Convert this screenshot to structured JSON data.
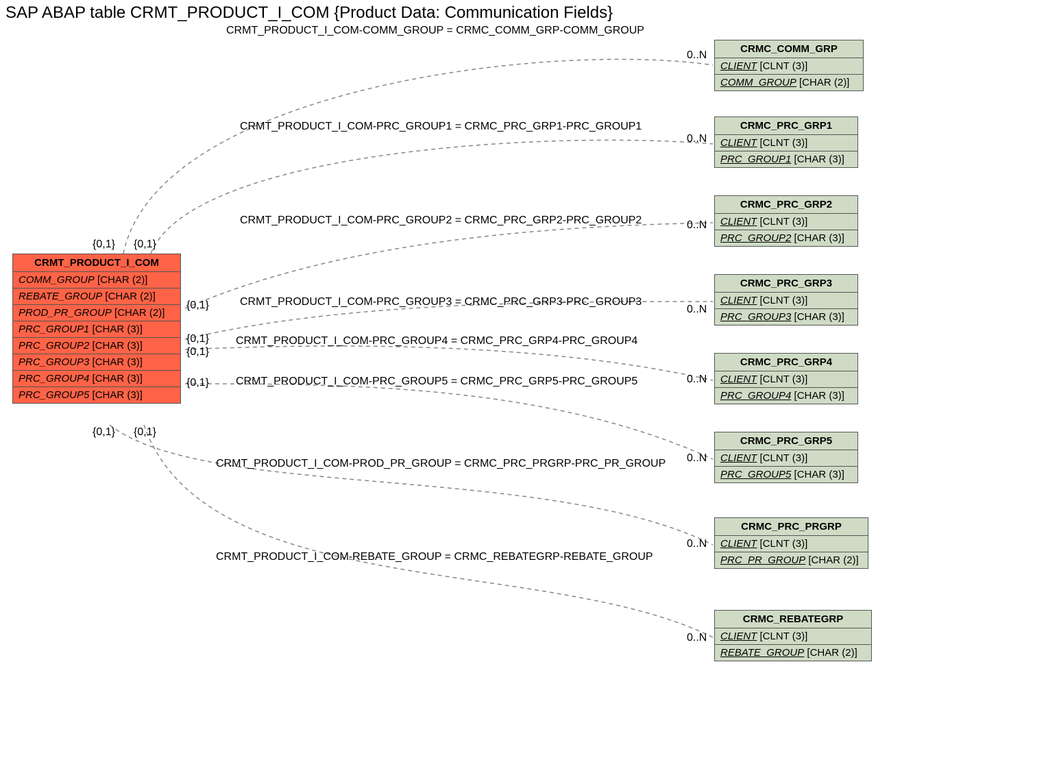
{
  "title": "SAP ABAP table CRMT_PRODUCT_I_COM {Product Data: Communication Fields}",
  "mainEntity": {
    "name": "CRMT_PRODUCT_I_COM",
    "fields": [
      {
        "name": "COMM_GROUP",
        "type": "[CHAR (2)]"
      },
      {
        "name": "REBATE_GROUP",
        "type": "[CHAR (2)]"
      },
      {
        "name": "PROD_PR_GROUP",
        "type": "[CHAR (2)]"
      },
      {
        "name": "PRC_GROUP1",
        "type": "[CHAR (3)]"
      },
      {
        "name": "PRC_GROUP2",
        "type": "[CHAR (3)]"
      },
      {
        "name": "PRC_GROUP3",
        "type": "[CHAR (3)]"
      },
      {
        "name": "PRC_GROUP4",
        "type": "[CHAR (3)]"
      },
      {
        "name": "PRC_GROUP5",
        "type": "[CHAR (3)]"
      }
    ]
  },
  "refEntities": [
    {
      "name": "CRMC_COMM_GRP",
      "fields": [
        {
          "name": "CLIENT",
          "type": "[CLNT (3)]",
          "u": true
        },
        {
          "name": "COMM_GROUP",
          "type": "[CHAR (2)]",
          "u": true
        }
      ]
    },
    {
      "name": "CRMC_PRC_GRP1",
      "fields": [
        {
          "name": "CLIENT",
          "type": "[CLNT (3)]",
          "u": true
        },
        {
          "name": "PRC_GROUP1",
          "type": "[CHAR (3)]",
          "u": true
        }
      ]
    },
    {
      "name": "CRMC_PRC_GRP2",
      "fields": [
        {
          "name": "CLIENT",
          "type": "[CLNT (3)]",
          "u": true
        },
        {
          "name": "PRC_GROUP2",
          "type": "[CHAR (3)]",
          "u": true
        }
      ]
    },
    {
      "name": "CRMC_PRC_GRP3",
      "fields": [
        {
          "name": "CLIENT",
          "type": "[CLNT (3)]",
          "u": true
        },
        {
          "name": "PRC_GROUP3",
          "type": "[CHAR (3)]",
          "u": true
        }
      ]
    },
    {
      "name": "CRMC_PRC_GRP4",
      "fields": [
        {
          "name": "CLIENT",
          "type": "[CLNT (3)]",
          "u": true
        },
        {
          "name": "PRC_GROUP4",
          "type": "[CHAR (3)]",
          "u": true
        }
      ]
    },
    {
      "name": "CRMC_PRC_GRP5",
      "fields": [
        {
          "name": "CLIENT",
          "type": "[CLNT (3)]",
          "u": true
        },
        {
          "name": "PRC_GROUP5",
          "type": "[CHAR (3)]",
          "u": true
        }
      ]
    },
    {
      "name": "CRMC_PRC_PRGRP",
      "fields": [
        {
          "name": "CLIENT",
          "type": "[CLNT (3)]",
          "u": true
        },
        {
          "name": "PRC_PR_GROUP",
          "type": "[CHAR (2)]",
          "u": true
        }
      ]
    },
    {
      "name": "CRMC_REBATEGRP",
      "fields": [
        {
          "name": "CLIENT",
          "type": "[CLNT (3)]",
          "u": true
        },
        {
          "name": "REBATE_GROUP",
          "type": "[CHAR (2)]",
          "u": true
        }
      ]
    }
  ],
  "relLabels": [
    "CRMT_PRODUCT_I_COM-COMM_GROUP = CRMC_COMM_GRP-COMM_GROUP",
    "CRMT_PRODUCT_I_COM-PRC_GROUP1 = CRMC_PRC_GRP1-PRC_GROUP1",
    "CRMT_PRODUCT_I_COM-PRC_GROUP2 = CRMC_PRC_GRP2-PRC_GROUP2",
    "CRMT_PRODUCT_I_COM-PRC_GROUP3 = CRMC_PRC_GRP3-PRC_GROUP3",
    "CRMT_PRODUCT_I_COM-PRC_GROUP4 = CRMC_PRC_GRP4-PRC_GROUP4",
    "CRMT_PRODUCT_I_COM-PRC_GROUP5 = CRMC_PRC_GRP5-PRC_GROUP5",
    "CRMT_PRODUCT_I_COM-PROD_PR_GROUP = CRMC_PRC_PRGRP-PRC_PR_GROUP",
    "CRMT_PRODUCT_I_COM-REBATE_GROUP = CRMC_REBATEGRP-REBATE_GROUP"
  ],
  "cardSource": [
    "{0,1}",
    "{0,1}",
    "{0,1}",
    "{0,1}",
    "{0,1}",
    "{0,1}",
    "{0,1}",
    "{0,1}"
  ],
  "cardTarget": [
    "0..N",
    "0..N",
    "0..N",
    "0..N",
    "0..N",
    "0..N",
    "0..N",
    "0..N"
  ]
}
